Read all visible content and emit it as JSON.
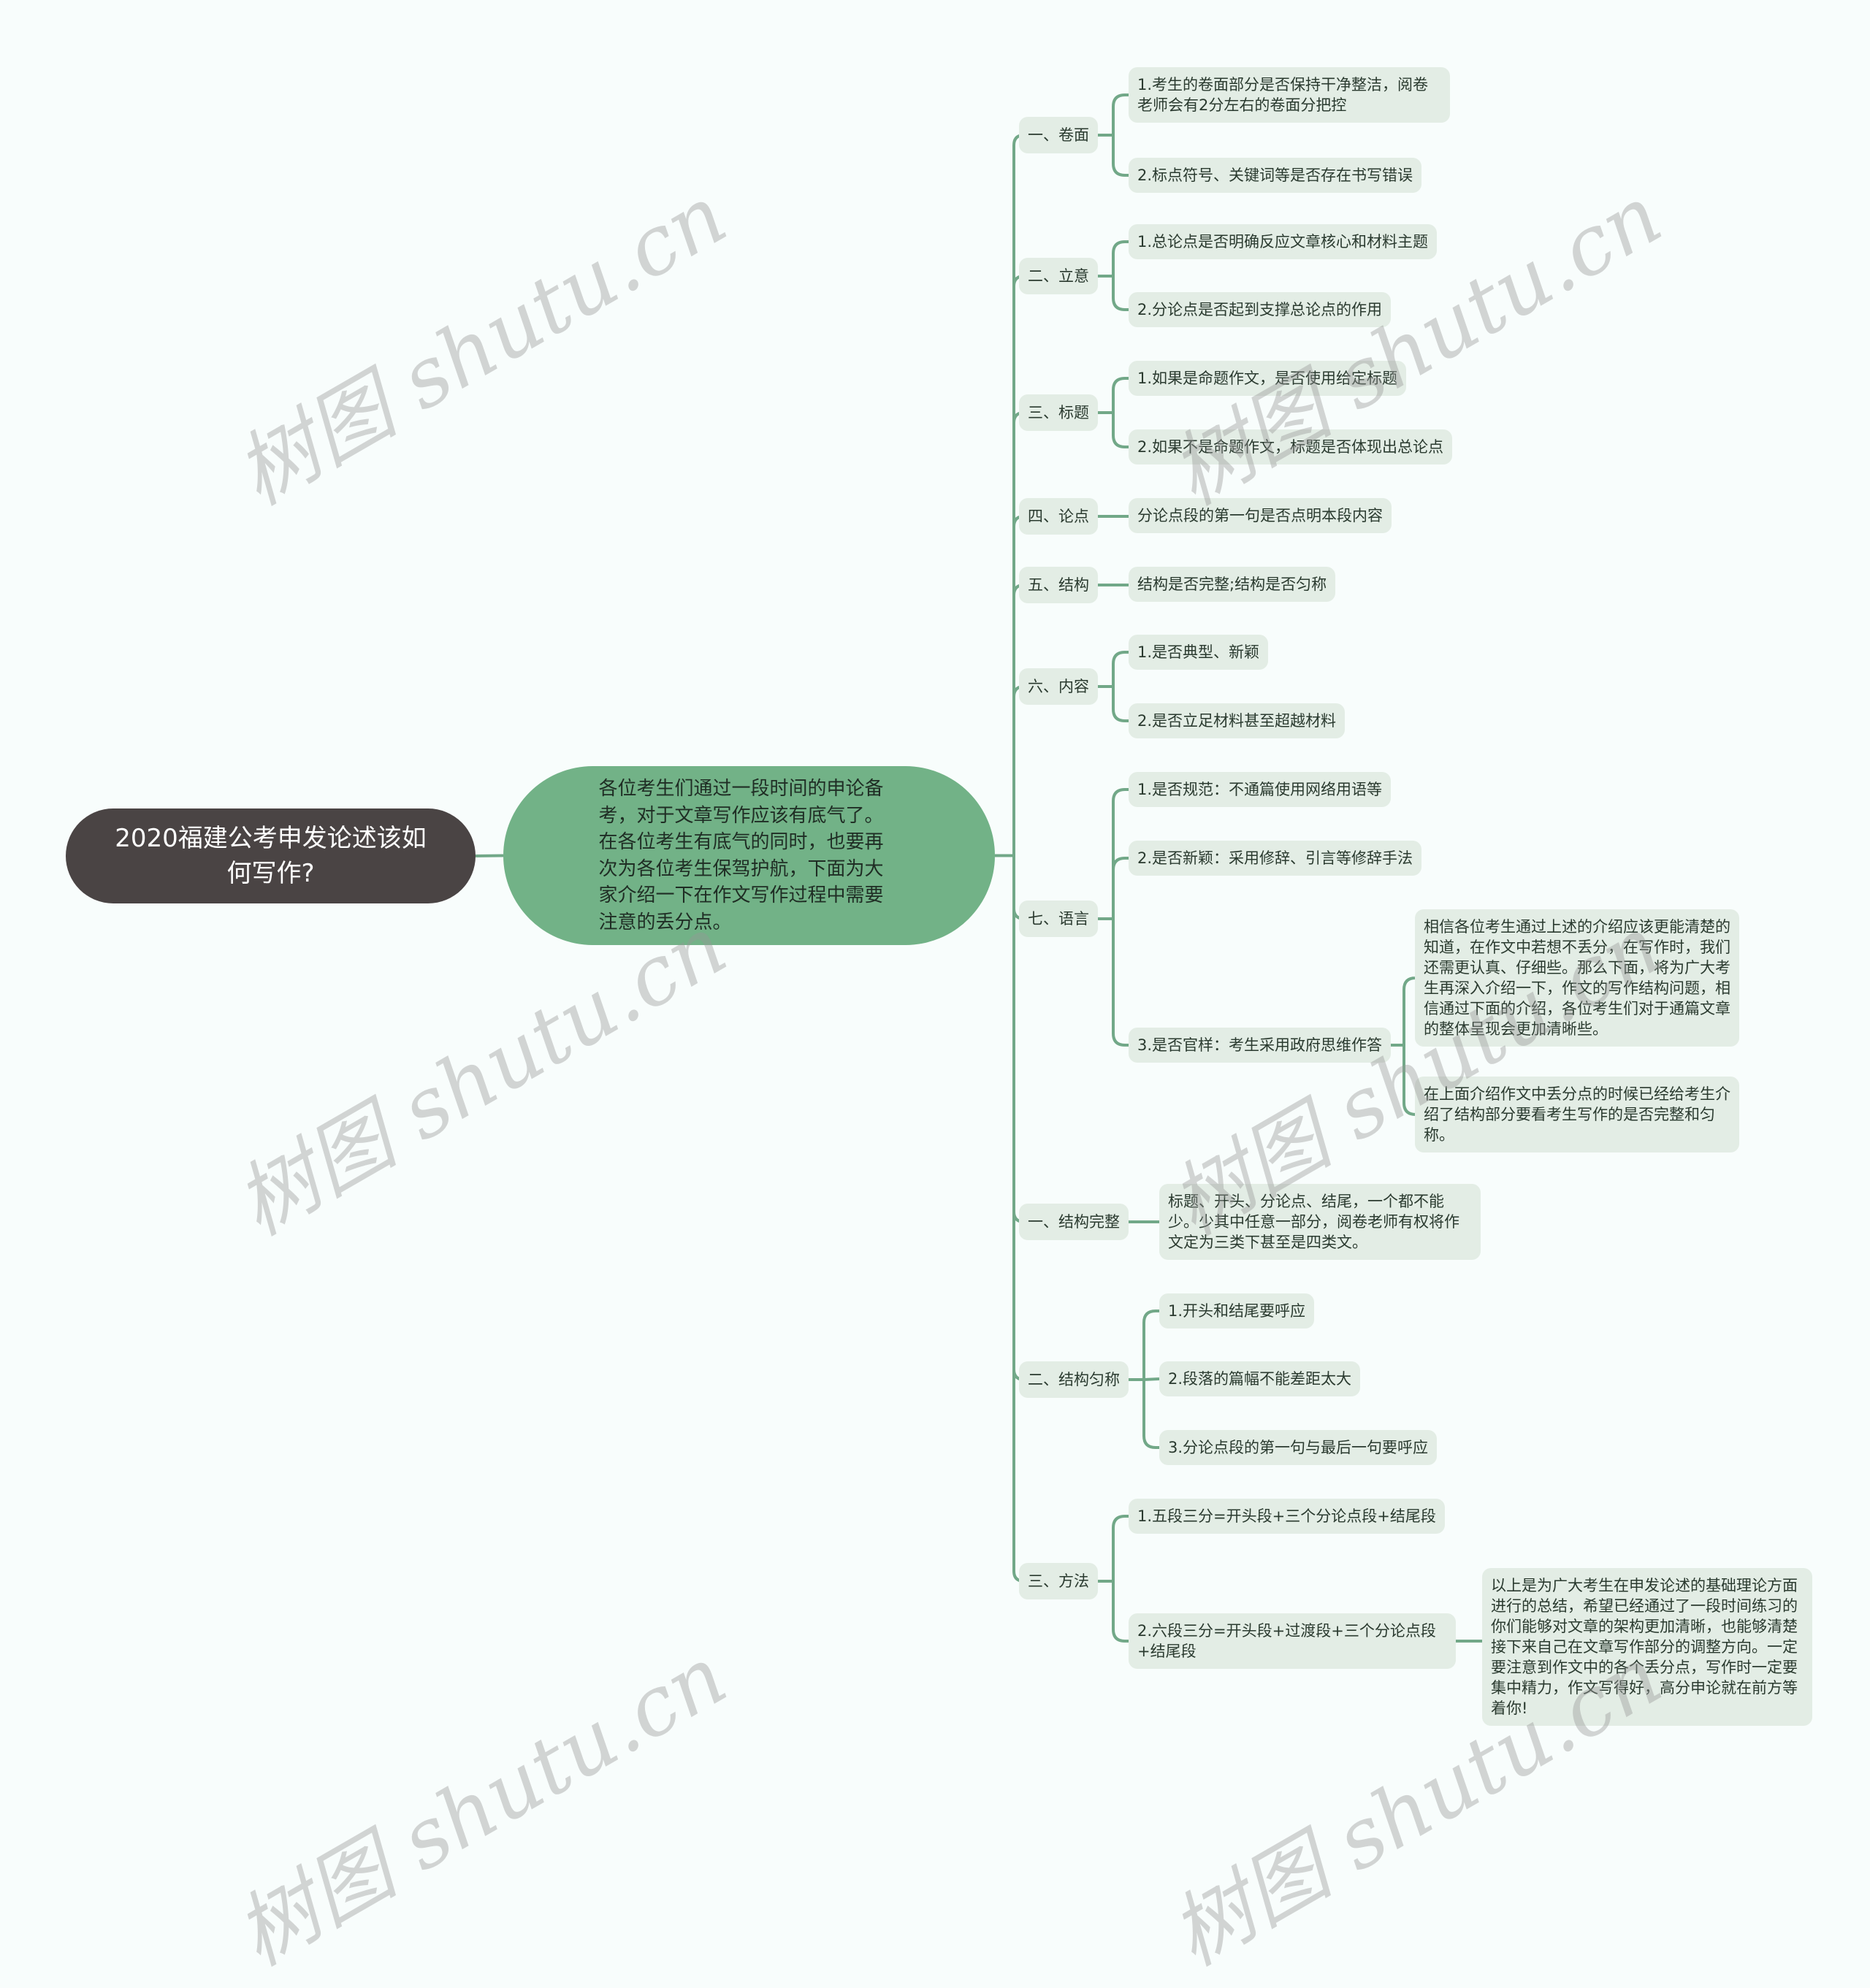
{
  "root": {
    "title": "2020福建公考申发论述该如何写作?"
  },
  "center": {
    "text": "各位考生们通过一段时间的申论备考，对于文章写作应该有底气了。在各位考生有底气的同时，也要再次为各位考生保驾护航，下面为大家介绍一下在作文写作过程中需要注意的丢分点。"
  },
  "colors": {
    "root_bg": "#4a4444",
    "center_bg": "#72b287",
    "node_bg": "#e3ede5",
    "line": "#72a888",
    "background": "#f8fdfc"
  },
  "branches": [
    {
      "label": "一、卷面",
      "children": [
        {
          "text": "1.考生的卷面部分是否保持干净整洁，阅卷老师会有2分左右的卷面分把控"
        },
        {
          "text": "2.标点符号、关键词等是否存在书写错误"
        }
      ]
    },
    {
      "label": "二、立意",
      "children": [
        {
          "text": "1.总论点是否明确反应文章核心和材料主题"
        },
        {
          "text": "2.分论点是否起到支撑总论点的作用"
        }
      ]
    },
    {
      "label": "三、标题",
      "children": [
        {
          "text": "1.如果是命题作文，是否使用给定标题"
        },
        {
          "text": "2.如果不是命题作文，标题是否体现出总论点"
        }
      ]
    },
    {
      "label": "四、论点",
      "children": [
        {
          "text": "分论点段的第一句是否点明本段内容"
        }
      ]
    },
    {
      "label": "五、结构",
      "children": [
        {
          "text": "结构是否完整;结构是否匀称"
        }
      ]
    },
    {
      "label": "六、内容",
      "children": [
        {
          "text": "1.是否典型、新颖"
        },
        {
          "text": "2.是否立足材料甚至超越材料"
        }
      ]
    },
    {
      "label": "七、语言",
      "children": [
        {
          "text": "1.是否规范：不通篇使用网络用语等"
        },
        {
          "text": "2.是否新颖：采用修辞、引言等修辞手法"
        },
        {
          "text": "3.是否官样：考生采用政府思维作答",
          "children": [
            {
              "text": "相信各位考生通过上述的介绍应该更能清楚的知道，在作文中若想不丢分，在写作时，我们还需更认真、仔细些。那么下面，将为广大考生再深入介绍一下，作文的写作结构问题，相信通过下面的介绍，各位考生们对于通篇文章的整体呈现会更加清晰些。"
            },
            {
              "text": "在上面介绍作文中丢分点的时候已经给考生介绍了结构部分要看考生写作的是否完整和匀称。"
            }
          ]
        }
      ]
    },
    {
      "label": "一、结构完整",
      "children": [
        {
          "text": "标题、开头、分论点、结尾，一个都不能少。少其中任意一部分，阅卷老师有权将作文定为三类下甚至是四类文。"
        }
      ]
    },
    {
      "label": "二、结构匀称",
      "children": [
        {
          "text": "1.开头和结尾要呼应"
        },
        {
          "text": "2.段落的篇幅不能差距太大"
        },
        {
          "text": "3.分论点段的第一句与最后一句要呼应"
        }
      ]
    },
    {
      "label": "三、方法",
      "children": [
        {
          "text": "1.五段三分=开头段+三个分论点段+结尾段"
        },
        {
          "text": "2.六段三分=开头段+过渡段+三个分论点段+结尾段",
          "children": [
            {
              "text": "以上是为广大考生在申发论述的基础理论方面进行的总结，希望已经通过了一段时间练习的你们能够对文章的架构更加清晰，也能够清楚接下来自己在文章写作部分的调整方向。一定要注意到作文中的各个丢分点，写作时一定要集中精力，作文写得好，高分申论就在前方等着你!"
            }
          ]
        }
      ]
    }
  ],
  "watermark": {
    "text": "树图 shutu.cn"
  }
}
